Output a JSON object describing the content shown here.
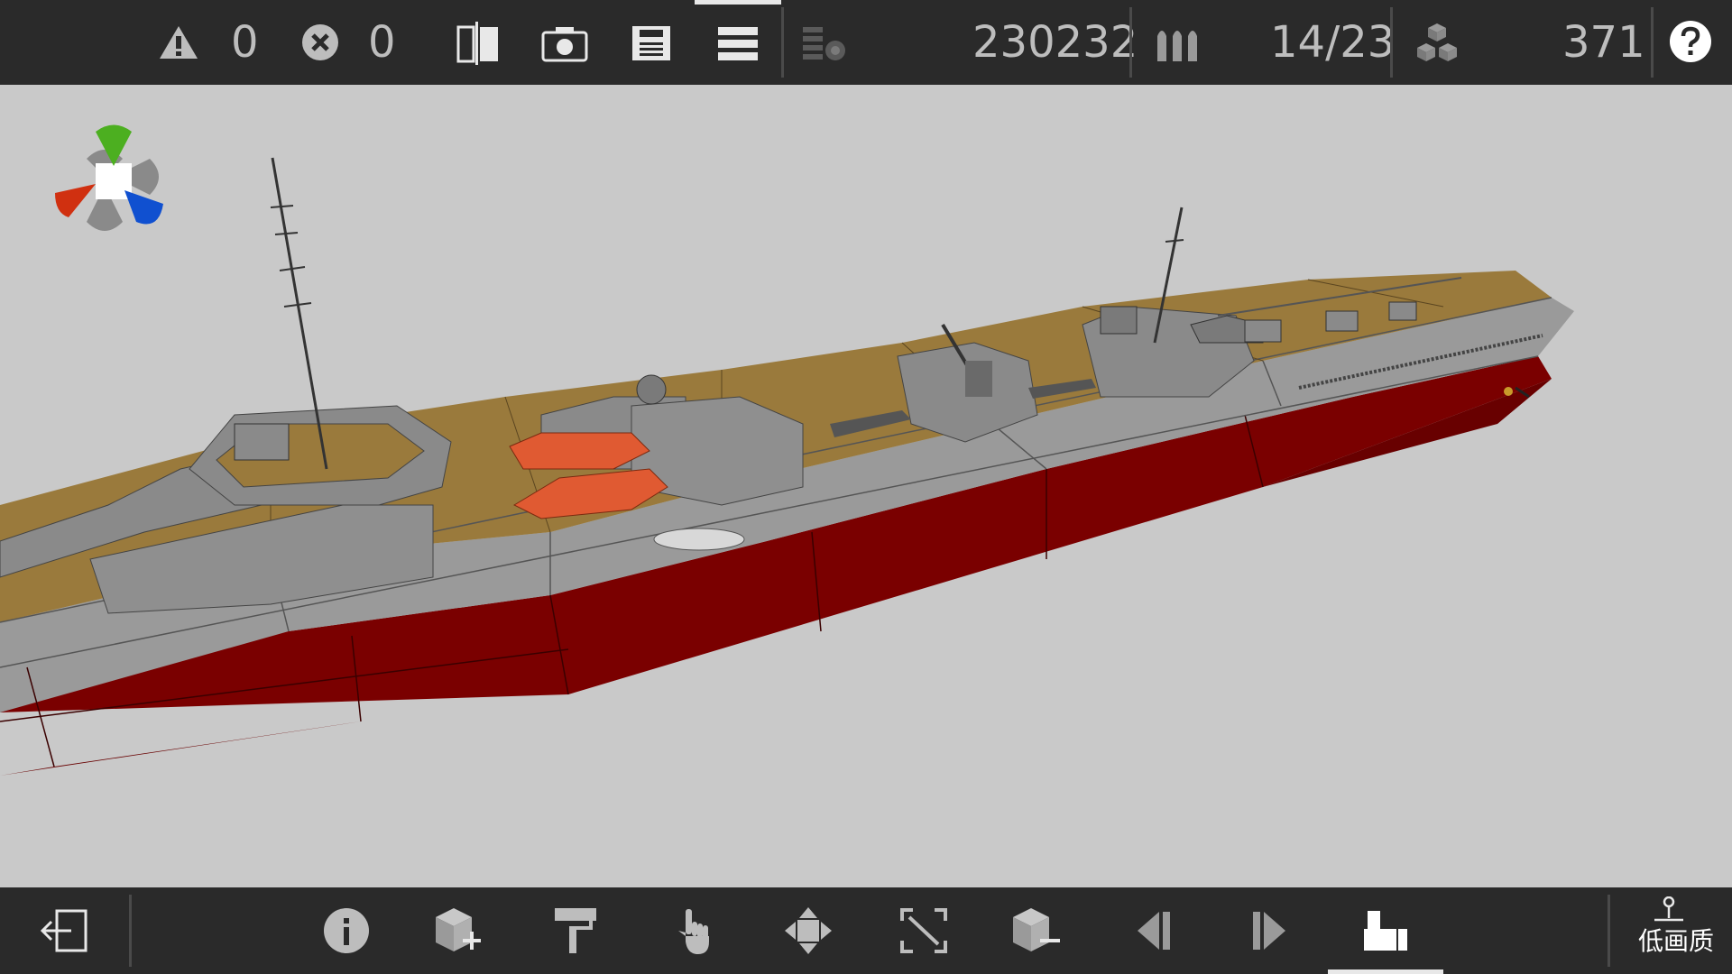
{
  "topbar": {
    "warnings_count": "0",
    "errors_count": "0",
    "points_value": "230232",
    "ammo_value": "14/23",
    "parts_value": "371"
  },
  "bottombar": {
    "quality_label": "低画质"
  },
  "colors": {
    "bar_bg": "#2a2a2a",
    "viewport_bg": "#c9c9c9",
    "hull_red": "#7a0000",
    "hull_gray": "#9a9a9a",
    "deck_tan": "#9a7a3c",
    "boat_orange": "#e05a32"
  },
  "icons": {
    "top": [
      "warning-icon",
      "error-icon",
      "split-view-icon",
      "camera-icon",
      "save-icon",
      "menu-icon",
      "layers-icon",
      "ammo-icon",
      "parts-icon",
      "help-icon"
    ],
    "bottom": [
      "exit-icon",
      "info-icon",
      "add-block-icon",
      "paint-roller-icon",
      "hand-select-icon",
      "move-icon",
      "scale-icon",
      "remove-block-icon",
      "previous-icon",
      "next-icon",
      "weapon-mount-icon",
      "quality-joystick-icon"
    ]
  }
}
